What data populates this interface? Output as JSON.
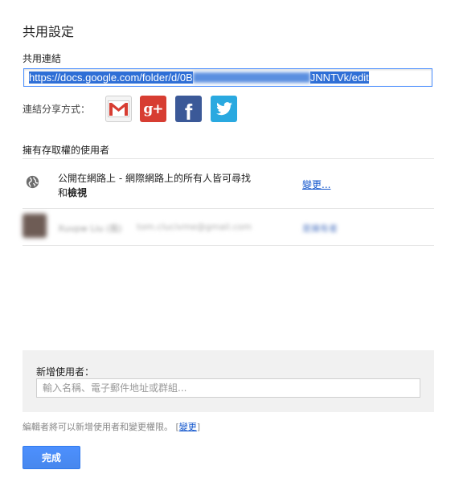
{
  "dialog": {
    "title": "共用設定"
  },
  "link_section": {
    "label": "共用連結",
    "url_prefix": "https://docs.google.com/folder/d/0B",
    "url_suffix": "JNNTVk/edit"
  },
  "share_via": {
    "label": "連結分享方式：",
    "services": [
      {
        "name": "gmail-icon",
        "color": "#d73d32"
      },
      {
        "name": "google-plus-icon",
        "glyph": "g+",
        "color": "#d73d32"
      },
      {
        "name": "facebook-icon",
        "glyph": "f",
        "color": "#3b5998"
      },
      {
        "name": "twitter-icon",
        "color": "#2aa9e0"
      }
    ]
  },
  "access": {
    "label": "擁有存取權的使用者",
    "public_line1": "公開在網路上 - 網際網路上的所有人皆可尋找",
    "public_line2_prefix": "和",
    "public_line2_bold": "檢視",
    "change_link": "變更...",
    "owner": {
      "name": "Xuvpw Liu (我)",
      "email": "tom.clucivme@gmail.com",
      "role": "是擁有者"
    }
  },
  "add_user": {
    "label": "新增使用者：",
    "placeholder": "輸入名稱、電子郵件地址或群組..."
  },
  "editor_note": {
    "text": "編輯者將可以新增使用者和變更權限。",
    "bracket_open": "[",
    "link": "變更",
    "bracket_close": "]"
  },
  "done_button": "完成",
  "colors": {
    "primary_button": "#4d90fe",
    "link": "#1155cc",
    "selection": "#2f6fd6"
  }
}
